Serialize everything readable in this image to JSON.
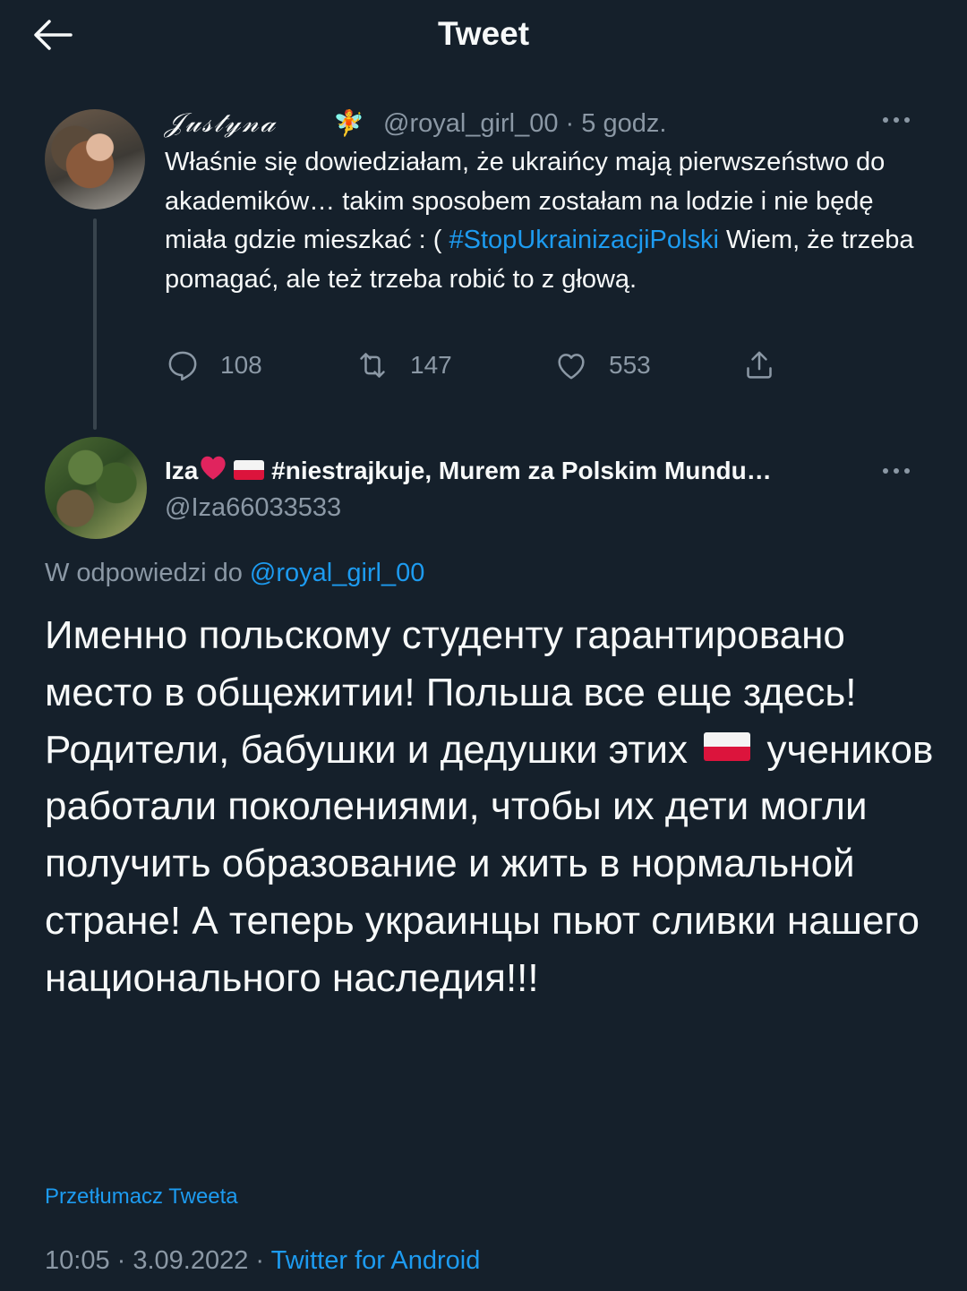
{
  "header": {
    "title": "Tweet",
    "back_icon": "arrow-left-icon"
  },
  "parent_tweet": {
    "display_name": "𝒥𝓊𝓈𝓉𝓎𝓃𝒶",
    "name_emoji": "🧚",
    "handle_time": "@royal_girl_00 · 5 godz.",
    "text_before": "Właśnie się dowiedziałam, że ukraińcy mają pierwszeństwo do akademików… takim sposobem zostałam na lodzie i nie będę miała gdzie mieszkać : ( ",
    "hashtag": "#StopUkrainizacjiPolski",
    "text_after": " Wiem, że trzeba pomagać, ale też trzeba robić to z głową.",
    "replies": "108",
    "retweets": "147",
    "likes": "553"
  },
  "reply_tweet": {
    "name_prefix": "Iza",
    "name_rest": " #niestrajkuje, Murem za Polskim Mundu…",
    "handle": "@Iza66033533",
    "replying_prefix": "W odpowiedzi do ",
    "replying_mention": "@royal_girl_00",
    "text_before_flag": "Именно польскому студенту гарантировано место в общежитии! Польша все еще здесь! Родители, бабушки и дедушки этих",
    "text_after_flag": "учеников работали поколениями, чтобы их дети могли получить образование и жить в нормальной стране! А теперь украинцы пьют сливки нашего национального наследия!!!",
    "translate_label": "Przetłumacz Tweeta",
    "timestamp": "10:05 · 3.09.2022 · ",
    "source": "Twitter for Android"
  },
  "colors": {
    "background": "#15202b",
    "text": "#f7f9f9",
    "muted": "#8b98a5",
    "accent": "#1d9bf0"
  }
}
